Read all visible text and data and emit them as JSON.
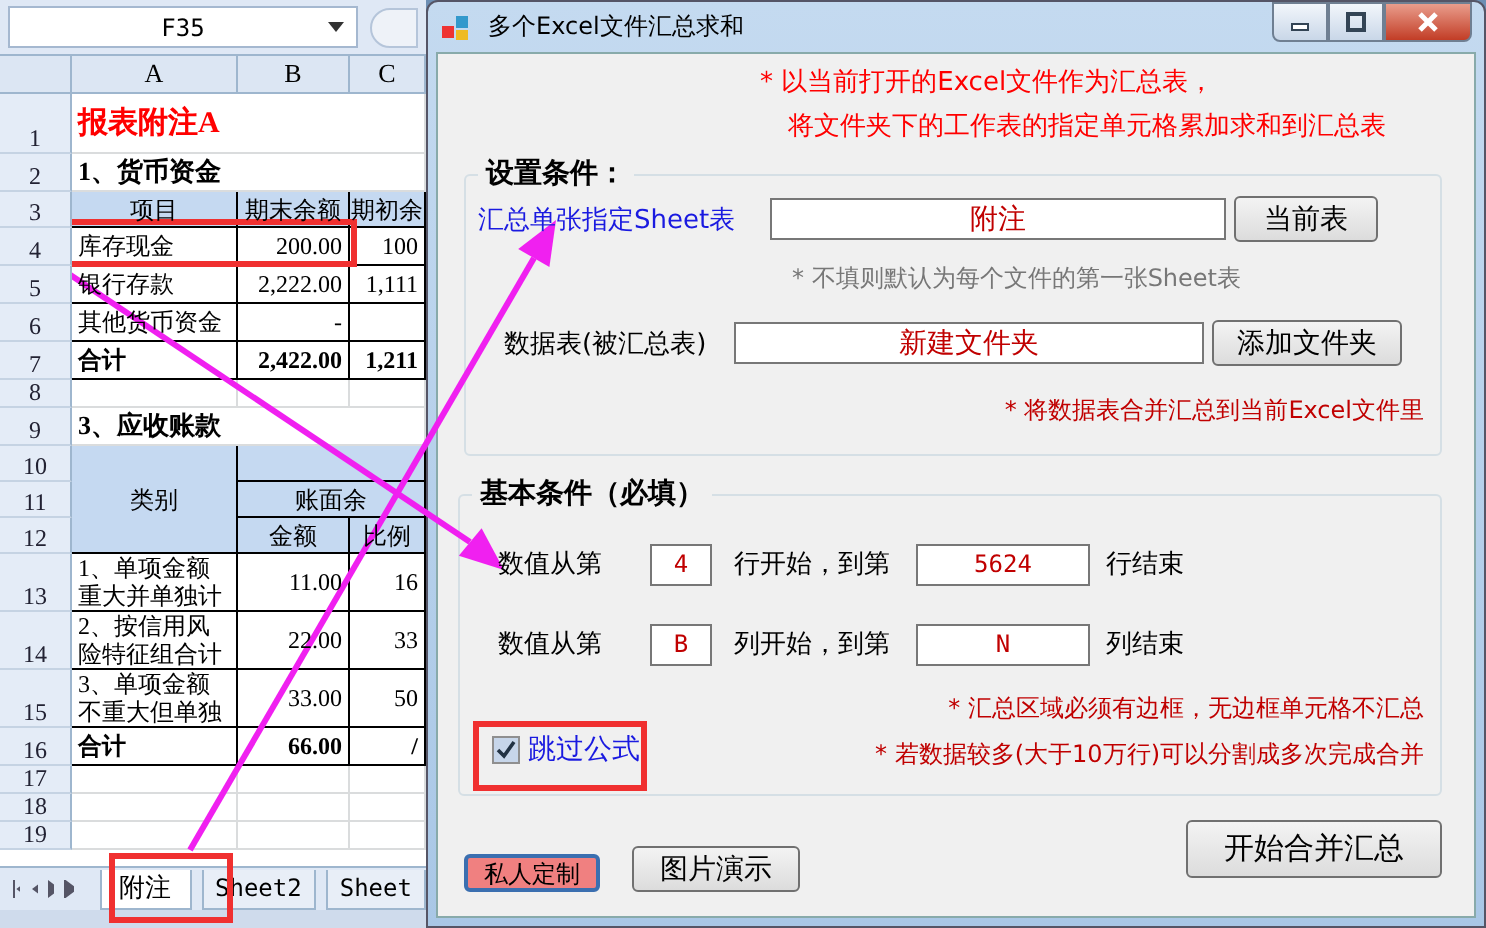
{
  "spreadsheet": {
    "name_box": "F35",
    "column_headers": [
      "A",
      "B",
      "C"
    ],
    "rows": [
      {
        "number": "1",
        "kind": "title",
        "cells": [
          "报表附注A"
        ]
      },
      {
        "number": "2",
        "kind": "section",
        "cells": [
          "1、货币资金"
        ]
      },
      {
        "number": "3",
        "kind": "header",
        "cells": [
          "项目",
          "期末余额",
          "期初余"
        ]
      },
      {
        "number": "4",
        "kind": "data",
        "cells": [
          "库存现金",
          "200.00",
          "100"
        ]
      },
      {
        "number": "5",
        "kind": "data",
        "cells": [
          "银行存款",
          "2,222.00",
          "1,111"
        ]
      },
      {
        "number": "6",
        "kind": "data",
        "cells": [
          "其他货币资金",
          "-"
        ]
      },
      {
        "number": "7",
        "kind": "total",
        "cells": [
          "合计",
          "2,422.00",
          "1,211"
        ]
      },
      {
        "number": "8",
        "kind": "blank"
      },
      {
        "number": "9",
        "kind": "section",
        "cells": [
          "3、应收账款"
        ]
      },
      {
        "kind": "group_header",
        "numbers": [
          "10",
          "11",
          "12"
        ],
        "category": "类别",
        "group": "账面余",
        "subheaders": [
          "金额",
          "比例"
        ]
      },
      {
        "number": "13",
        "kind": "data",
        "cells": [
          "1、单项金额重大并单独计",
          "11.00",
          "16"
        ]
      },
      {
        "number": "14",
        "kind": "data",
        "cells": [
          "2、按信用风险特征组合计",
          "22.00",
          "33"
        ]
      },
      {
        "number": "15",
        "kind": "data",
        "cells": [
          "3、单项金额不重大但单独",
          "33.00",
          "50"
        ]
      },
      {
        "number": "16",
        "kind": "total",
        "cells": [
          "合计",
          "66.00",
          "/"
        ]
      },
      {
        "number": "17",
        "kind": "blank"
      },
      {
        "number": "18",
        "kind": "blank"
      },
      {
        "number": "19",
        "kind": "blank"
      }
    ],
    "sheet_tabs": [
      {
        "label": "附注",
        "selected": true
      },
      {
        "label": "Sheet2",
        "selected": false
      },
      {
        "label": "Sheet",
        "selected": false
      }
    ]
  },
  "dialog": {
    "title": "多个Excel文件汇总求和",
    "intro": [
      "* 以当前打开的Excel文件作为汇总表，",
      "将文件夹下的工作表的指定单元格累加求和到汇总表"
    ],
    "settings": {
      "legend": "设置条件：",
      "sheet_label": "汇总单张指定Sheet表",
      "sheet_value": "附注",
      "sheet_button": "当前表",
      "sheet_hint": "* 不填则默认为每个文件的第一张Sheet表",
      "data_label": "数据表(被汇总表)",
      "data_value": "新建文件夹",
      "data_button": "添加文件夹",
      "data_note": "* 将数据表合并汇总到当前Excel文件里"
    },
    "basic": {
      "legend": "基本条件（必填）",
      "ranges": [
        {
          "prefix": "数值从第",
          "start": "4",
          "middle": "行开始，到第",
          "end": "5624",
          "suffix": "行结束"
        },
        {
          "prefix": "数值从第",
          "start": "B",
          "middle": "列开始，到第",
          "end": "N",
          "suffix": "列结束"
        }
      ],
      "notes": [
        "* 汇总区域必须有边框，无边框单元格不汇总",
        "* 若数据较多(大于10万行)可以分割成多次完成合并"
      ],
      "skip_formulas": {
        "label": "跳过公式",
        "checked": true
      }
    },
    "buttons": {
      "custom": "私人定制",
      "demo": "图片演示",
      "start": "开始合并汇总"
    }
  }
}
